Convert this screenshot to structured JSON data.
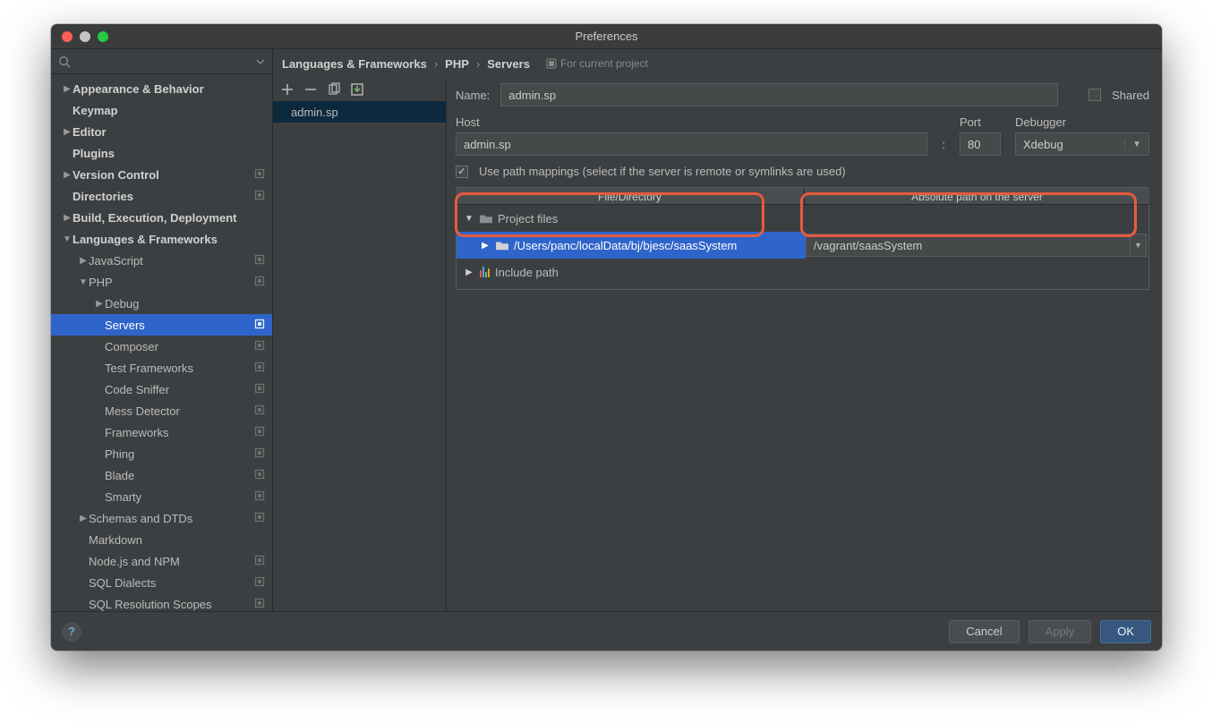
{
  "window": {
    "title": "Preferences"
  },
  "breadcrumb": [
    "Languages & Frameworks",
    "PHP",
    "Servers"
  ],
  "currentProjectLabel": "For current project",
  "sidebar": {
    "items": [
      {
        "label": "Appearance & Behavior",
        "depth": 0,
        "arrow": "▶",
        "bold": true
      },
      {
        "label": "Keymap",
        "depth": 0,
        "bold": true
      },
      {
        "label": "Editor",
        "depth": 0,
        "arrow": "▶",
        "bold": true
      },
      {
        "label": "Plugins",
        "depth": 0,
        "bold": true
      },
      {
        "label": "Version Control",
        "depth": 0,
        "arrow": "▶",
        "bold": true,
        "mod": true
      },
      {
        "label": "Directories",
        "depth": 0,
        "bold": true,
        "mod": true
      },
      {
        "label": "Build, Execution, Deployment",
        "depth": 0,
        "arrow": "▶",
        "bold": true
      },
      {
        "label": "Languages & Frameworks",
        "depth": 0,
        "arrow": "▼",
        "bold": true
      },
      {
        "label": "JavaScript",
        "depth": 1,
        "arrow": "▶",
        "mod": true
      },
      {
        "label": "PHP",
        "depth": 1,
        "arrow": "▼",
        "mod": true
      },
      {
        "label": "Debug",
        "depth": 2,
        "arrow": "▶"
      },
      {
        "label": "Servers",
        "depth": 2,
        "selected": true,
        "mod": true
      },
      {
        "label": "Composer",
        "depth": 2,
        "mod": true
      },
      {
        "label": "Test Frameworks",
        "depth": 2,
        "mod": true
      },
      {
        "label": "Code Sniffer",
        "depth": 2,
        "mod": true
      },
      {
        "label": "Mess Detector",
        "depth": 2,
        "mod": true
      },
      {
        "label": "Frameworks",
        "depth": 2,
        "mod": true
      },
      {
        "label": "Phing",
        "depth": 2,
        "mod": true
      },
      {
        "label": "Blade",
        "depth": 2,
        "mod": true
      },
      {
        "label": "Smarty",
        "depth": 2,
        "mod": true
      },
      {
        "label": "Schemas and DTDs",
        "depth": 1,
        "arrow": "▶",
        "mod": true
      },
      {
        "label": "Markdown",
        "depth": 1
      },
      {
        "label": "Node.js and NPM",
        "depth": 1,
        "mod": true
      },
      {
        "label": "SQL Dialects",
        "depth": 1,
        "mod": true
      },
      {
        "label": "SQL Resolution Scopes",
        "depth": 1,
        "mod": true
      }
    ]
  },
  "serverList": {
    "selected": "admin.sp"
  },
  "form": {
    "nameLabel": "Name:",
    "name": "admin.sp",
    "sharedLabel": "Shared",
    "hostLabel": "Host",
    "host": "admin.sp",
    "sep": ":",
    "portLabel": "Port",
    "port": "80",
    "debuggerLabel": "Debugger",
    "debugger": "Xdebug",
    "usePathLabel": "Use path mappings (select if the server is remote or symlinks are used)",
    "tableHeaders": {
      "left": "File/Directory",
      "right": "Absolute path on the server"
    },
    "rows": {
      "project": "Project files",
      "path": "/Users/panc/localData/bj/bjesc/saasSystem",
      "remote": "/vagrant/saasSystem",
      "include": "Include path"
    }
  },
  "footer": {
    "cancel": "Cancel",
    "apply": "Apply",
    "ok": "OK"
  }
}
